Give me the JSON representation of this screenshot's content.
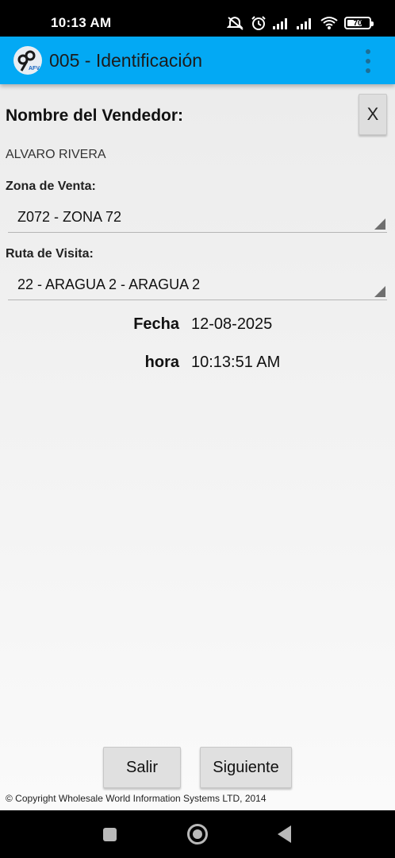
{
  "status_bar": {
    "time": "10:13 AM",
    "battery_percent": 70,
    "battery_label": "70",
    "icons": [
      "mute-icon",
      "alarm-icon",
      "signal-icon",
      "signal-icon",
      "wifi-icon",
      "battery-icon"
    ]
  },
  "app_bar": {
    "title": "005 - Identificación",
    "logo_text": "AFV",
    "menu_icon": "overflow-menu-icon",
    "color": "#03a9f4"
  },
  "form": {
    "seller_heading": "Nombre del Vendedor:",
    "close_label": "X",
    "seller_name": "ALVARO RIVERA",
    "zone_label": "Zona de Venta:",
    "zone_value": "Z072 - ZONA 72",
    "route_label": "Ruta de Visita:",
    "route_value": "22 - ARAGUA 2 - ARAGUA 2",
    "date_label": "Fecha",
    "date_value": "12-08-2025",
    "time_label": "hora",
    "time_value": "10:13:51 AM"
  },
  "buttons": {
    "exit_label": "Salir",
    "next_label": "Siguiente"
  },
  "footer": {
    "copyright": "© Copyright Wholesale World Information Systems LTD, 2014"
  },
  "navigation": {
    "icons": [
      "recent-apps-icon",
      "home-icon",
      "back-icon"
    ]
  }
}
